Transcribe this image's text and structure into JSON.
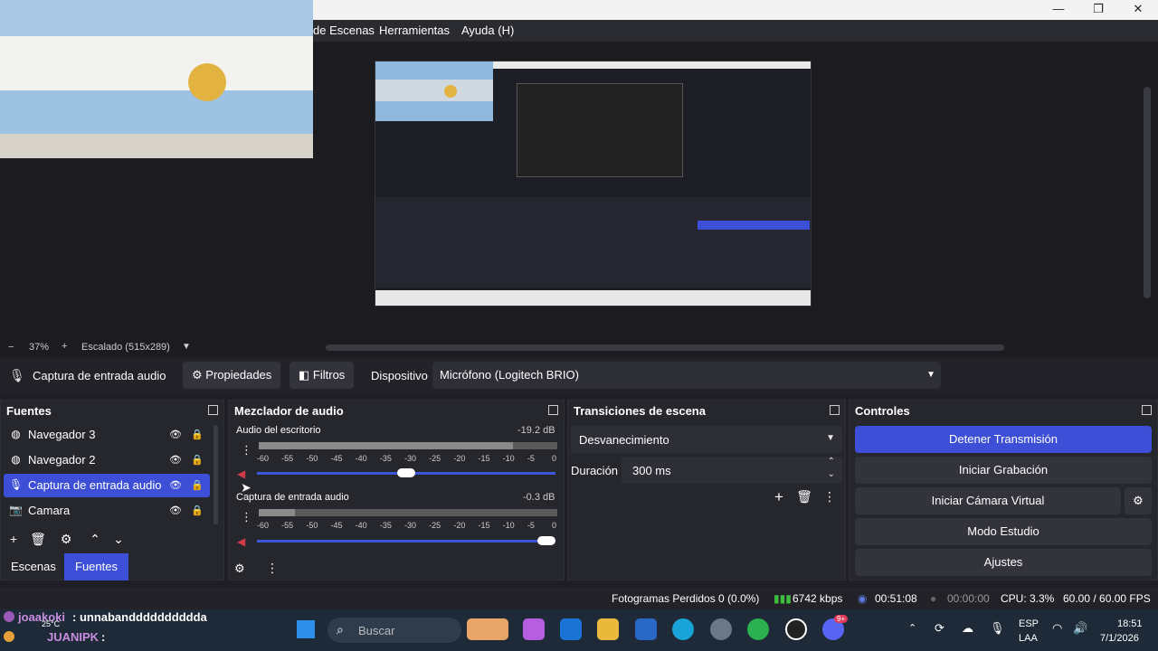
{
  "menu": {
    "scenes_fragment": "de Escenas",
    "tools": "Herramientas",
    "help": "Ayuda (H)"
  },
  "window": {
    "minimize": "—",
    "maximize": "❐",
    "close": "✕"
  },
  "zoom": {
    "minus": "−",
    "percent": "37%",
    "plus": "+",
    "scaling": "Escalado (515x289)"
  },
  "source_toolbar": {
    "source_name": "Captura de entrada audio",
    "properties": "Propiedades",
    "filters": "Filtros",
    "device_label": "Dispositivo",
    "device_value": "Micrófono (Logitech BRIO)"
  },
  "sources": {
    "title": "Fuentes",
    "items": [
      {
        "label": "Navegador 3",
        "icon": "globe-icon"
      },
      {
        "label": "Navegador 2",
        "icon": "globe-icon"
      },
      {
        "label": "Captura de entrada audio",
        "icon": "microphone-icon"
      },
      {
        "label": "Camara",
        "icon": "camera-icon"
      }
    ],
    "tabs": {
      "scenes": "Escenas",
      "sources": "Fuentes"
    }
  },
  "mixer": {
    "title": "Mezclador de audio",
    "ticks": [
      "-60",
      "-55",
      "-50",
      "-45",
      "-40",
      "-35",
      "-30",
      "-25",
      "-20",
      "-15",
      "-10",
      "-5",
      "0"
    ],
    "channels": [
      {
        "name": "Audio del escritorio",
        "db": "-19.2 dB",
        "level": 0.85,
        "volume": 0.5
      },
      {
        "name": "Captura de entrada audio",
        "db": "-0.3 dB",
        "level": 0.12,
        "volume": 1.0
      }
    ]
  },
  "transitions": {
    "title": "Transiciones de escena",
    "type": "Desvanecimiento",
    "duration_label": "Duración",
    "duration_value": "300 ms"
  },
  "controls": {
    "title": "Controles",
    "stop_stream": "Detener Transmisión",
    "start_recording": "Iniciar Grabación",
    "start_virtual_cam": "Iniciar Cámara Virtual",
    "studio_mode": "Modo Estudio",
    "settings": "Ajustes"
  },
  "status": {
    "dropped_frames": "Fotogramas Perdidos 0 (0.0%)",
    "bitrate": "6742 kbps",
    "stream_time": "00:51:08",
    "rec_time": "00:00:00",
    "cpu": "CPU: 3.3%",
    "fps": "60.00 / 60.00 FPS"
  },
  "chat": {
    "line1_user": "joaakoki",
    "line1_msg": ": unnabandddddddddda",
    "line2_user": "JUANIPK",
    "line2_msg": ":",
    "temp": "25°C"
  },
  "taskbar": {
    "search": "Buscar",
    "lang": "ESP",
    "region": "LAA",
    "time": "18:51",
    "date": "7/1/2026",
    "badge": "9+"
  },
  "colors": {
    "accent": "#3c4fd6",
    "mute_red": "#d23a4a",
    "volume_blue": "#3d55d8",
    "signal_green": "#3fbf3f"
  }
}
